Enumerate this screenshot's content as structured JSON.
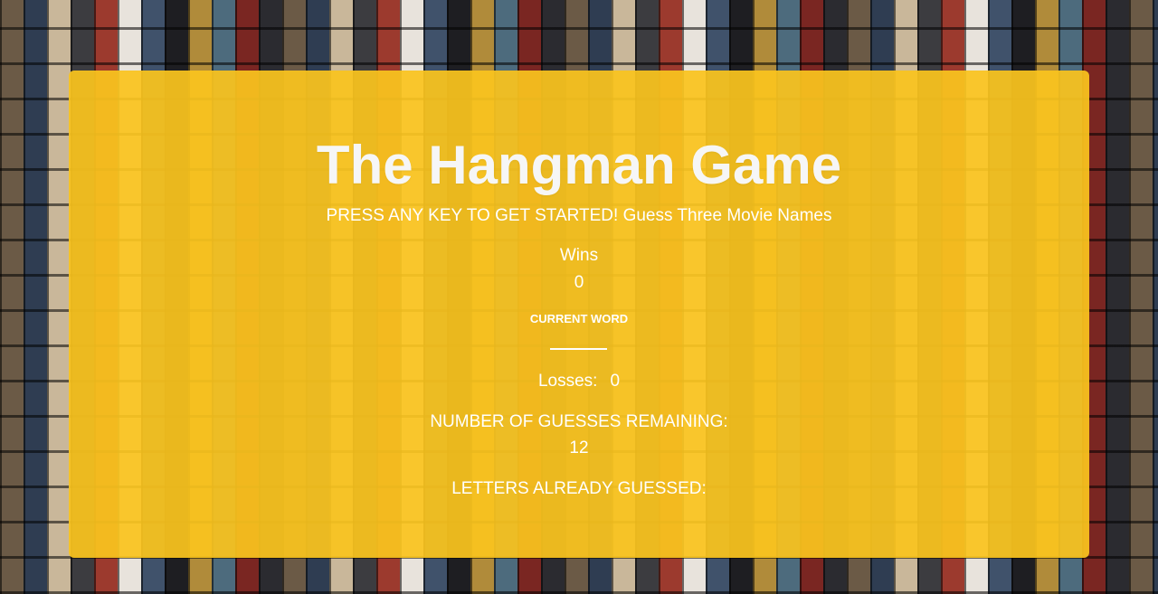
{
  "game": {
    "title": "The Hangman Game",
    "instructions": "PRESS ANY KEY TO GET STARTED! Guess Three Movie Names",
    "wins_label": "Wins",
    "wins_value": "0",
    "current_word_label": "CURRENT WORD",
    "current_word_value": "",
    "losses_label": "Losses:",
    "losses_value": "0",
    "guesses_label": "NUMBER OF GUESSES REMAINING:",
    "guesses_value": "12",
    "letters_label": "LETTERS ALREADY GUESSED:",
    "letters_value": ""
  },
  "colors": {
    "panel": "#fac41e",
    "text": "#ffffff"
  }
}
